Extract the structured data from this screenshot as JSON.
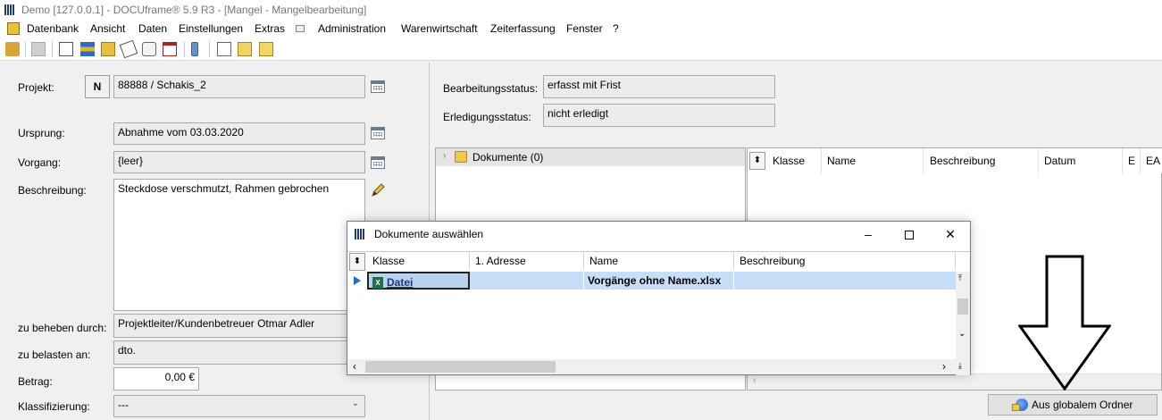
{
  "window": {
    "title": "Demo [127.0.0.1] - DOCUframe® 5.9 R3 - [Mangel - Mangelbearbeitung]"
  },
  "menu": {
    "items": [
      "Datenbank",
      "Ansicht",
      "Daten",
      "Einstellungen",
      "Extras",
      "Administration",
      "Warenwirtschaft",
      "Zeiterfassung",
      "Fenster",
      "?"
    ]
  },
  "form": {
    "projekt": {
      "label": "Projekt:",
      "badge": "N",
      "value": "88888 / Schakis_2"
    },
    "ursprung": {
      "label": "Ursprung:",
      "value": "Abnahme vom 03.03.2020"
    },
    "vorgang": {
      "label": "Vorgang:",
      "value": "{leer}"
    },
    "beschreibung": {
      "label": "Beschreibung:",
      "value": "Steckdose verschmutzt, Rahmen gebrochen"
    },
    "zu_beheben": {
      "label": "zu beheben durch:",
      "value": "Projektleiter/Kundenbetreuer Otmar Adler"
    },
    "zu_belasten": {
      "label": "zu belasten an:",
      "value": "dto."
    },
    "betrag": {
      "label": "Betrag:",
      "value": "0,00 €"
    },
    "klassifizierung": {
      "label": "Klassifizierung:",
      "value": "---"
    }
  },
  "status": {
    "bearbeitung": {
      "label": "Bearbeitungsstatus:",
      "value": "erfasst mit Frist"
    },
    "erledigung": {
      "label": "Erledigungsstatus:",
      "value": "nicht erledigt"
    }
  },
  "tree": {
    "root_label": "Dokumente (0)"
  },
  "grid": {
    "columns": [
      "Klasse",
      "Name",
      "Beschreibung",
      "Datum",
      "E",
      "EA"
    ]
  },
  "dialog": {
    "title": "Dokumente auswählen",
    "columns": [
      "Klasse",
      "1. Adresse",
      "Name",
      "Beschreibung"
    ],
    "rows": [
      {
        "klasse": "Datei",
        "adresse": "",
        "name": "Vorgänge ohne Name.xlsx",
        "beschreibung": ""
      }
    ]
  },
  "buttons": {
    "aus_globalem_ordner": "Aus globalem Ordner"
  },
  "colors": {
    "selection": "#c6def7",
    "arrow": "#000000"
  }
}
